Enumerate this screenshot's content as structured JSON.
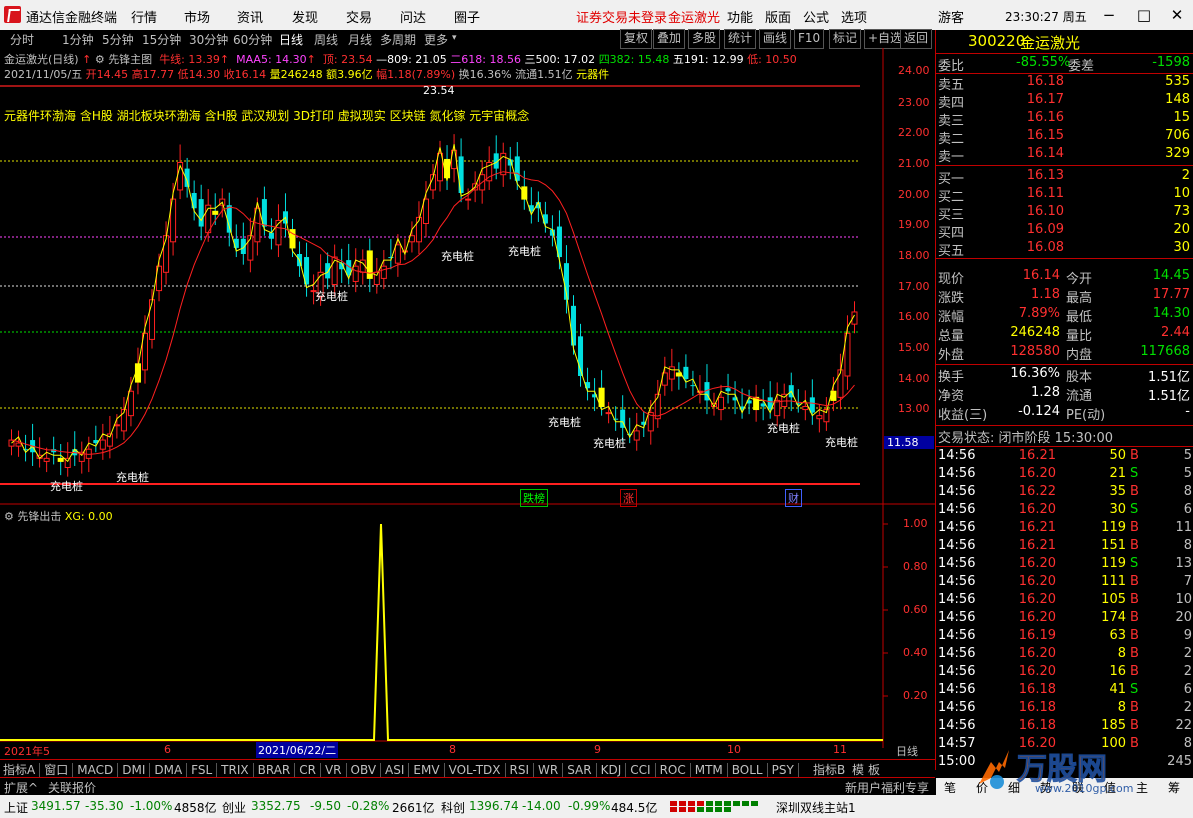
{
  "titlebar": {
    "app_name": "通达信金融终端",
    "menus": [
      "行情",
      "市场",
      "资讯",
      "发现",
      "交易",
      "问达",
      "圈子"
    ],
    "warning": "证券交易未登录",
    "stock_name": "金运激光",
    "right_menus": [
      "功能",
      "版面",
      "公式",
      "选项"
    ],
    "user": "游客",
    "clock": "23:30:27 周五",
    "min_icon": "−",
    "max_icon": "□",
    "close_icon": "✕"
  },
  "periods": [
    "分时",
    "1分钟",
    "5分钟",
    "15分钟",
    "30分钟",
    "60分钟",
    "日线",
    "周线",
    "月线",
    "多周期",
    "更多"
  ],
  "toolbar_buttons": [
    "复权",
    "叠加",
    "多股",
    "统计",
    "画线",
    "F10",
    "标记",
    "+自选",
    "返回"
  ],
  "chart_header": {
    "name": "金运激光(日线)",
    "indicator": "先锋主图",
    "niu": "牛线: 13.39",
    "maa5": "MAA5: 14.30",
    "top": "顶: 23.54",
    "fib809": "—809: 21.05",
    "fib618": "二618: 18.56",
    "three500": "三500: 17.02",
    "four382": "四382: 15.48",
    "five191": "五191: 12.99",
    "low": "低: 10.50"
  },
  "chart_info2": {
    "date": "2021/11/05/五",
    "open": "开14.45",
    "high": "高17.77",
    "low": "低14.30",
    "close": "收16.14",
    "volume": "量246248",
    "amount": "额3.96亿",
    "change": "幅1.18(7.89%)",
    "turnover": "换16.36%",
    "float": "流通1.51亿",
    "concept": "元器件"
  },
  "concepts": "元器件环渤海 含H股 湖北板块环渤海 含H股 武汉规划 3D打印 虚拟现实 区块链 氮化镓 元宇宙概念",
  "peak_label": "23.54",
  "signal_labels": [
    "充电桩",
    "充电桩",
    "充电桩",
    "充电桩",
    "充电桩",
    "充电桩",
    "充电桩",
    "充电桩",
    "充电桩"
  ],
  "event_tags": [
    "跌榜",
    "涨",
    "财"
  ],
  "price_axis": [
    "24.00",
    "23.00",
    "22.00",
    "21.00",
    "20.00",
    "19.00",
    "18.00",
    "17.00",
    "16.00",
    "15.00",
    "14.00",
    "13.00",
    "12.00"
  ],
  "cursor_price": "11.58",
  "sub_indicator": {
    "title": "先锋出击",
    "xg": "XG: 0.00",
    "axis": [
      "1.00",
      "0.80",
      "0.60",
      "0.40",
      "0.20"
    ]
  },
  "date_axis": {
    "labels": [
      "2021年5",
      "6",
      "2021/06/22/二",
      "8",
      "9",
      "10",
      "11"
    ],
    "period": "日线"
  },
  "indicator_tabs": [
    "指标A",
    "窗口",
    "MACD",
    "DMI",
    "DMA",
    "FSL",
    "TRIX",
    "BRAR",
    "CR",
    "VR",
    "OBV",
    "ASI",
    "EMV",
    "VOL-TDX",
    "RSI",
    "WR",
    "SAR",
    "KDJ",
    "CCI",
    "ROC",
    "MTM",
    "BOLL",
    "PSY"
  ],
  "indicator_right": [
    "指标B",
    "模",
    "板"
  ],
  "expand_tabs": [
    "扩展^",
    "关联报价"
  ],
  "quote": {
    "code": "300220",
    "name": "金运激光",
    "weibi_label": "委比",
    "weibi": "-85.55%",
    "weicha_label": "委差",
    "weicha": "-1598",
    "asks": [
      {
        "label": "卖五",
        "price": "16.18",
        "vol": "535"
      },
      {
        "label": "卖四",
        "price": "16.17",
        "vol": "148"
      },
      {
        "label": "卖三",
        "price": "16.16",
        "vol": "15"
      },
      {
        "label": "卖二",
        "price": "16.15",
        "vol": "706"
      },
      {
        "label": "卖一",
        "price": "16.14",
        "vol": "329"
      }
    ],
    "bids": [
      {
        "label": "买一",
        "price": "16.13",
        "vol": "2"
      },
      {
        "label": "买二",
        "price": "16.11",
        "vol": "10"
      },
      {
        "label": "买三",
        "price": "16.10",
        "vol": "73"
      },
      {
        "label": "买四",
        "price": "16.09",
        "vol": "20"
      },
      {
        "label": "买五",
        "price": "16.08",
        "vol": "30"
      }
    ],
    "stats": [
      {
        "l1": "现价",
        "v1": "16.14",
        "c1": "#ff3030",
        "l2": "今开",
        "v2": "14.45",
        "c2": "#00e000"
      },
      {
        "l1": "涨跌",
        "v1": "1.18",
        "c1": "#ff3030",
        "l2": "最高",
        "v2": "17.77",
        "c2": "#ff3030"
      },
      {
        "l1": "涨幅",
        "v1": "7.89%",
        "c1": "#ff3030",
        "l2": "最低",
        "v2": "14.30",
        "c2": "#00e000"
      },
      {
        "l1": "总量",
        "v1": "246248",
        "c1": "#ffff00",
        "l2": "量比",
        "v2": "2.44",
        "c2": "#ff3030"
      },
      {
        "l1": "外盘",
        "v1": "128580",
        "c1": "#ff3030",
        "l2": "内盘",
        "v2": "117668",
        "c2": "#00e000"
      }
    ],
    "stats2": [
      {
        "l1": "换手",
        "v1": "16.36%",
        "l2": "股本",
        "v2": "1.51亿"
      },
      {
        "l1": "净资",
        "v1": "1.28",
        "l2": "流通",
        "v2": "1.51亿"
      },
      {
        "l1": "收益(三)",
        "v1": "-0.124",
        "l2": "PE(动)",
        "v2": "-"
      }
    ],
    "trade_state": "交易状态: 闭市阶段 15:30:00",
    "ticks": [
      {
        "t": "14:56",
        "p": "16.21",
        "v": "50",
        "d": "B",
        "n": "5"
      },
      {
        "t": "14:56",
        "p": "16.20",
        "v": "21",
        "d": "S",
        "n": "5"
      },
      {
        "t": "14:56",
        "p": "16.22",
        "v": "35",
        "d": "B",
        "n": "8"
      },
      {
        "t": "14:56",
        "p": "16.20",
        "v": "30",
        "d": "S",
        "n": "6"
      },
      {
        "t": "14:56",
        "p": "16.21",
        "v": "119",
        "d": "B",
        "n": "11"
      },
      {
        "t": "14:56",
        "p": "16.21",
        "v": "151",
        "d": "B",
        "n": "8"
      },
      {
        "t": "14:56",
        "p": "16.20",
        "v": "119",
        "d": "S",
        "n": "13"
      },
      {
        "t": "14:56",
        "p": "16.20",
        "v": "111",
        "d": "B",
        "n": "7"
      },
      {
        "t": "14:56",
        "p": "16.20",
        "v": "105",
        "d": "B",
        "n": "10"
      },
      {
        "t": "14:56",
        "p": "16.20",
        "v": "174",
        "d": "B",
        "n": "20"
      },
      {
        "t": "14:56",
        "p": "16.19",
        "v": "63",
        "d": "B",
        "n": "9"
      },
      {
        "t": "14:56",
        "p": "16.20",
        "v": "8",
        "d": "B",
        "n": "2"
      },
      {
        "t": "14:56",
        "p": "16.20",
        "v": "16",
        "d": "B",
        "n": "2"
      },
      {
        "t": "14:56",
        "p": "16.18",
        "v": "41",
        "d": "S",
        "n": "6"
      },
      {
        "t": "14:56",
        "p": "16.18",
        "v": "8",
        "d": "B",
        "n": "2"
      },
      {
        "t": "14:56",
        "p": "16.18",
        "v": "185",
        "d": "B",
        "n": "22"
      },
      {
        "t": "14:57",
        "p": "16.20",
        "v": "100",
        "d": "B",
        "n": "8"
      },
      {
        "t": "15:00",
        "p": "",
        "v": "",
        "d": "",
        "n": "245"
      }
    ],
    "bottom_tabs": [
      "笔",
      "价",
      "细",
      "势",
      "联",
      "值",
      "主",
      "筹"
    ]
  },
  "news_ticker": "新用户福利专享",
  "statusbar": {
    "sh_label": "上证",
    "sh_val": "3491.57",
    "sh_chg": "-35.30",
    "sh_pct": "-1.00%",
    "sh_amt": "4858亿",
    "cy_label": "创业",
    "cy_val": "3352.75",
    "cy_chg": "-9.50",
    "cy_pct": "-0.28%",
    "cy_amt": "2661亿",
    "kc_label": "科创",
    "kc_val": "1396.74",
    "kc_chg": "-14.00",
    "kc_pct": "-0.99%",
    "kc_amt": "484.5亿",
    "server": "深圳双线主站1"
  },
  "watermark": {
    "text": "万股网",
    "url": "www.2010gp.com"
  }
}
